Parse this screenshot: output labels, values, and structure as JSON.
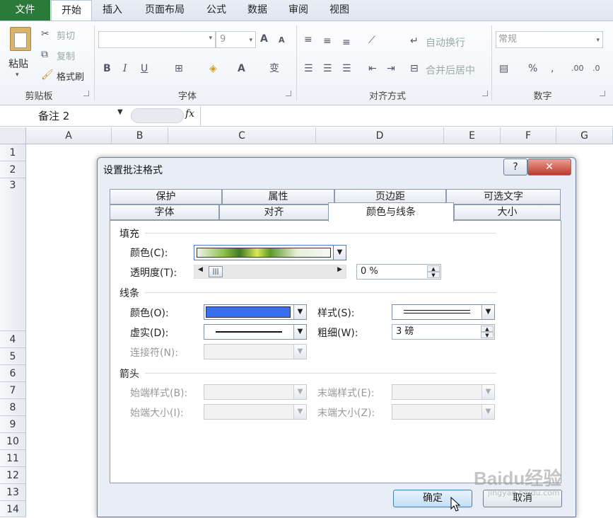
{
  "ribbon": {
    "tabs": [
      "文件",
      "开始",
      "插入",
      "页面布局",
      "公式",
      "数据",
      "审阅",
      "视图"
    ],
    "clipboard": {
      "paste": "粘贴",
      "cut": "剪切",
      "copy": "复制",
      "painter": "格式刷",
      "group": "剪贴板"
    },
    "font": {
      "size": "9",
      "bold": "B",
      "italic": "I",
      "underline": "U",
      "group": "字体",
      "grow": "A",
      "shrink": "A",
      "wen": "变"
    },
    "align": {
      "wrap": "自动换行",
      "merge": "合并后居中",
      "group": "对齐方式"
    },
    "number": {
      "format": "常规",
      "percent": "%",
      "comma": ",",
      "inc": ".00",
      "dec": ".0",
      "group": "数字"
    }
  },
  "formula": {
    "namebox": "备注 2",
    "fx": "fx"
  },
  "columns": [
    "A",
    "B",
    "C",
    "D",
    "E",
    "F",
    "G"
  ],
  "rows": [
    "1",
    "2",
    "3",
    "4",
    "5",
    "6",
    "7",
    "8",
    "9",
    "10",
    "11",
    "12",
    "13",
    "14"
  ],
  "dialog": {
    "title": "设置批注格式",
    "help": "?",
    "close": "✕",
    "tabs_top": [
      "保护",
      "属性",
      "页边距",
      "可选文字"
    ],
    "tabs_bottom": [
      "字体",
      "对齐",
      "颜色与线条",
      "大小"
    ],
    "fill": {
      "section": "填充",
      "color_label": "颜色(C):",
      "transparency_label": "透明度(T):",
      "transparency_value": "0 %"
    },
    "line": {
      "section": "线条",
      "color_label": "颜色(O):",
      "dash_label": "虚实(D):",
      "connector_label": "连接符(N):",
      "style_label": "样式(S):",
      "weight_label": "粗细(W):",
      "weight_value": "3 磅",
      "line_color": "#3a6ef0"
    },
    "arrows": {
      "section": "箭头",
      "begin_style": "始端样式(B):",
      "begin_size": "始端大小(I):",
      "end_style": "末端样式(E):",
      "end_size": "末端大小(Z):"
    },
    "ok": "确定",
    "cancel": "取消"
  },
  "watermark": {
    "text": "Baidu经验",
    "url": "jingyan.baidu.com"
  }
}
